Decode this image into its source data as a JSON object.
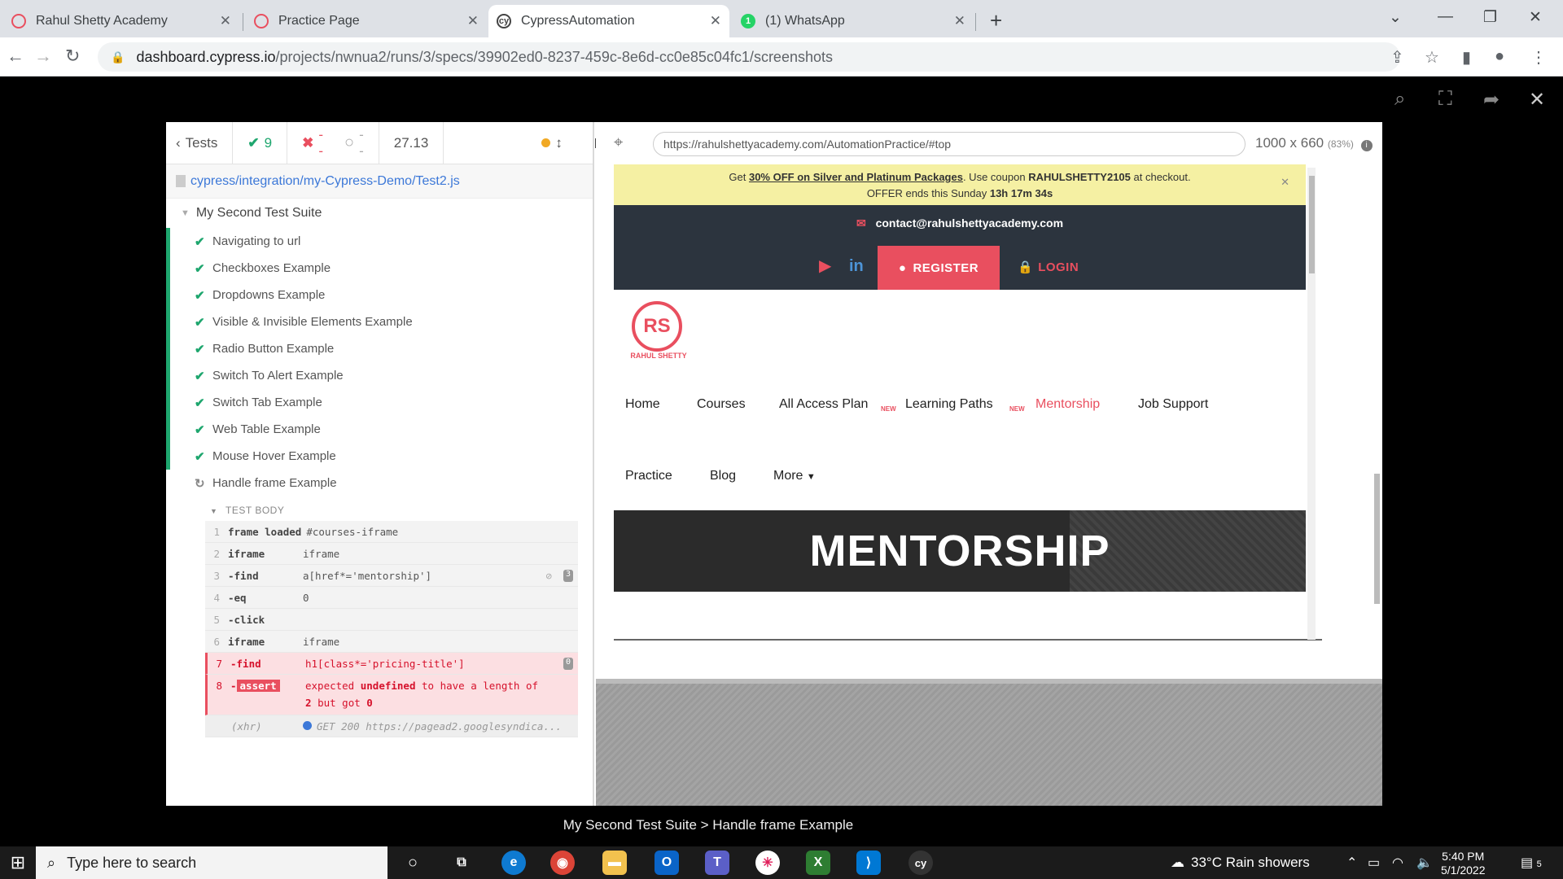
{
  "browser": {
    "tabs": [
      {
        "title": "Rahul Shetty Academy",
        "active": false
      },
      {
        "title": "Practice Page",
        "active": false
      },
      {
        "title": "CypressAutomation",
        "active": true
      },
      {
        "title": "(1) WhatsApp",
        "active": false
      }
    ],
    "url_host": "dashboard.cypress.io",
    "url_path": "/projects/nwnua2/runs/3/specs/39902ed0-8237-459c-8e6d-cc0e85c04fc1/screenshots"
  },
  "reporter": {
    "tests_label": "Tests",
    "passed": "9",
    "failed": "--",
    "pending": "--",
    "duration": "27.13",
    "spec_path": "cypress/integration/my-Cypress-Demo/Test2.js",
    "suite": "My Second Test Suite",
    "tests": [
      {
        "title": "Navigating to url",
        "state": "passed"
      },
      {
        "title": "Checkboxes Example",
        "state": "passed"
      },
      {
        "title": "Dropdowns Example",
        "state": "passed"
      },
      {
        "title": "Visible & Invisible Elements Example",
        "state": "passed"
      },
      {
        "title": "Radio Button Example",
        "state": "passed"
      },
      {
        "title": "Switch To Alert Example",
        "state": "passed"
      },
      {
        "title": "Switch Tab Example",
        "state": "passed"
      },
      {
        "title": "Web Table Example",
        "state": "passed"
      },
      {
        "title": "Mouse Hover Example",
        "state": "passed"
      },
      {
        "title": "Handle frame Example",
        "state": "running"
      }
    ],
    "test_body_label": "TEST BODY",
    "commands": [
      {
        "num": "1",
        "name": "frame loaded",
        "msg": "#courses-iframe"
      },
      {
        "num": "2",
        "name": "iframe",
        "msg": "iframe"
      },
      {
        "num": "3",
        "name": "-find",
        "msg": "a[href*='mentorship']",
        "badge": "3"
      },
      {
        "num": "4",
        "name": "-eq",
        "msg": "0"
      },
      {
        "num": "5",
        "name": "-click",
        "msg": ""
      },
      {
        "num": "6",
        "name": "iframe",
        "msg": "iframe"
      },
      {
        "num": "7",
        "name": "-find",
        "msg": "h1[class*='pricing-title']",
        "badge": "0"
      }
    ],
    "assert": {
      "num": "8",
      "name": "assert",
      "msg_pre": "expected",
      "msg_key": "undefined",
      "msg_mid": "to have a length of",
      "msg_line2_pre": "2",
      "msg_line2_mid": "but got",
      "msg_line2_val": "0"
    },
    "xhr": {
      "name": "(xhr)",
      "msg": "GET 200 https://pagead2.googlesyndica..."
    }
  },
  "aut": {
    "url": "https://rahulshettyacademy.com/AutomationPractice/#top",
    "size": "1000 x 660",
    "scale": "(83%)"
  },
  "site": {
    "promo_get": "Get",
    "promo_offer": "30% OFF on Silver and Platinum Packages",
    "promo_coupon_pre": ". Use coupon",
    "promo_coupon": "RAHULSHETTY2105",
    "promo_coupon_post": "at checkout.",
    "promo_ends": "OFFER ends this Sunday",
    "promo_time": "13h 17m 34s",
    "contact": "contact@rahulshettyacademy.com",
    "register": "REGISTER",
    "login": "LOGIN",
    "logo_text": "RAHUL SHETTY",
    "nav": [
      "Home",
      "Courses",
      "All Access Plan",
      "Learning Paths",
      "Mentorship",
      "Job Support",
      "Practice",
      "Blog",
      "More"
    ],
    "new_tag": "NEW",
    "hero": "MENTORSHIP"
  },
  "caption": "My Second Test Suite > Handle frame Example",
  "taskbar": {
    "search_placeholder": "Type here to search",
    "weather": "33°C  Rain showers",
    "time": "5:40 PM",
    "date": "5/1/2022",
    "notifications": "5"
  },
  "colors": {
    "accent": "#e94f5f",
    "passed": "#1ea66e",
    "link": "#3c78d8"
  }
}
